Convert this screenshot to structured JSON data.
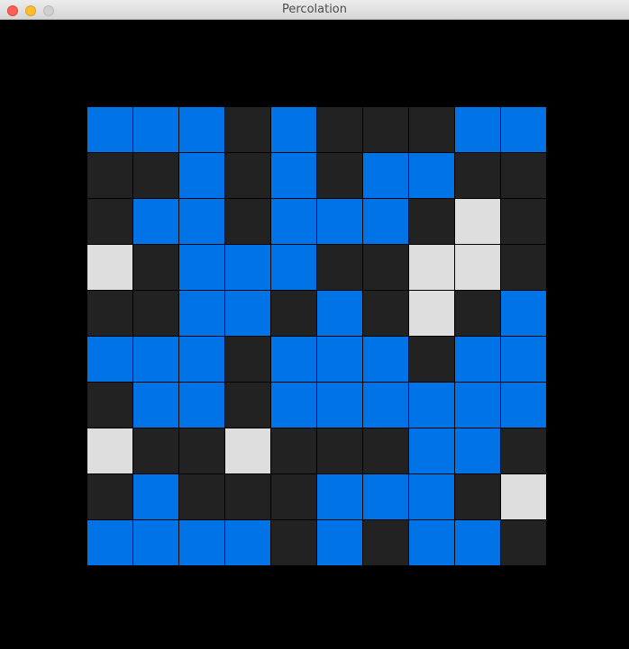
{
  "window": {
    "title": "Percolation"
  },
  "colors": {
    "full": "#0073e6",
    "blocked": "#222222",
    "open": "#dedede",
    "background": "#000000"
  },
  "grid": {
    "size": 10,
    "legend": {
      "F": "full",
      "B": "blocked",
      "O": "open"
    },
    "rows": [
      [
        "F",
        "F",
        "F",
        "B",
        "F",
        "B",
        "B",
        "B",
        "F",
        "F"
      ],
      [
        "B",
        "B",
        "F",
        "B",
        "F",
        "B",
        "F",
        "F",
        "B",
        "B"
      ],
      [
        "B",
        "F",
        "F",
        "B",
        "F",
        "F",
        "F",
        "B",
        "O",
        "B"
      ],
      [
        "O",
        "B",
        "F",
        "F",
        "F",
        "B",
        "B",
        "O",
        "O",
        "B"
      ],
      [
        "B",
        "B",
        "F",
        "F",
        "B",
        "F",
        "B",
        "O",
        "B",
        "F"
      ],
      [
        "F",
        "F",
        "F",
        "B",
        "F",
        "F",
        "F",
        "B",
        "F",
        "F"
      ],
      [
        "B",
        "F",
        "F",
        "B",
        "F",
        "F",
        "F",
        "F",
        "F",
        "F"
      ],
      [
        "O",
        "B",
        "B",
        "O",
        "B",
        "B",
        "B",
        "F",
        "F",
        "B"
      ],
      [
        "B",
        "F",
        "B",
        "B",
        "B",
        "F",
        "F",
        "F",
        "B",
        "O"
      ],
      [
        "F",
        "F",
        "F",
        "F",
        "B",
        "F",
        "B",
        "F",
        "F",
        "B"
      ]
    ]
  }
}
